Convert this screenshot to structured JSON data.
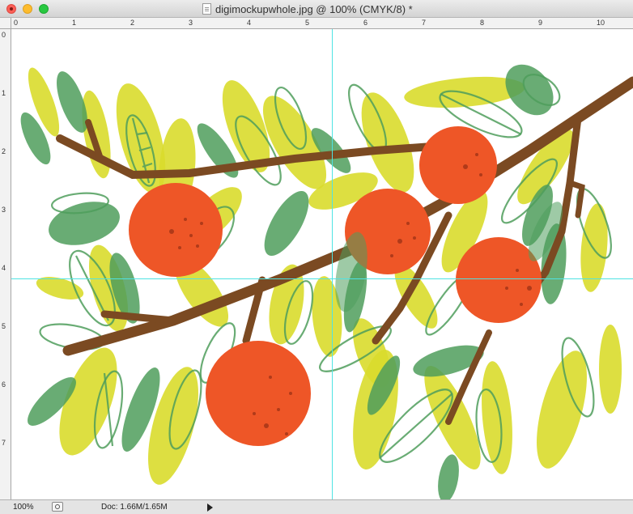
{
  "window": {
    "title": "digimockupwhole.jpg @ 100% (CMYK/8) *"
  },
  "ruler": {
    "top_labels": [
      "0",
      "1",
      "2",
      "3",
      "4",
      "5",
      "6",
      "7",
      "8",
      "9",
      "10"
    ],
    "left_labels": [
      "0",
      "1",
      "2",
      "3",
      "4",
      "5",
      "6",
      "7"
    ]
  },
  "status": {
    "zoom": "100%",
    "doc_size": "Doc: 1.66M/1.65M"
  },
  "colors": {
    "leaf_yellow": "#d9dc2c",
    "leaf_green": "#4f9e5c",
    "branch": "#7b4a22",
    "fruit": "#ee5627",
    "guide": "#4fe3e3"
  }
}
